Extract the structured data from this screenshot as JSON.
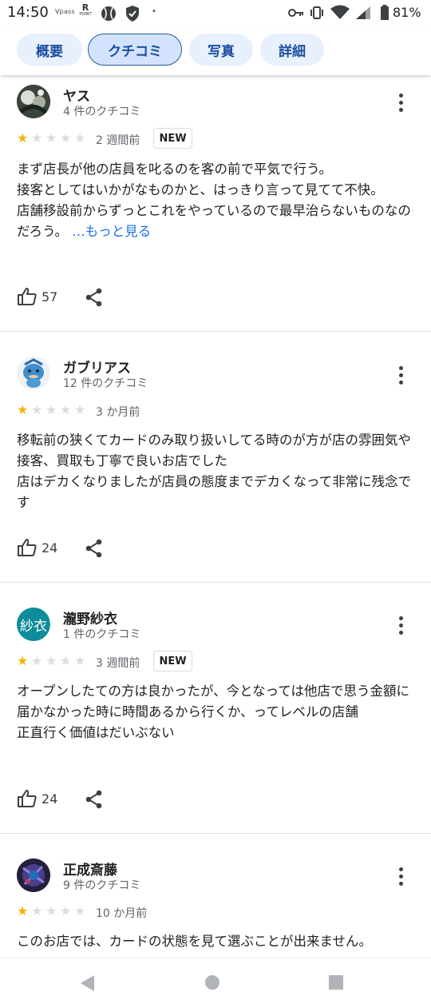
{
  "status_bar": {
    "time": "14:50",
    "app_icons": [
      "Vpass",
      "R POINT",
      "ball-icon",
      "shield-icon"
    ],
    "vpass_label": "Vpass",
    "rpoint_r": "R",
    "rpoint_label": "POINT",
    "dot": "•",
    "battery_percent": "81%"
  },
  "tabs": [
    {
      "label": "概要",
      "active": false
    },
    {
      "label": "クチコミ",
      "active": true
    },
    {
      "label": "写真",
      "active": false
    },
    {
      "label": "詳細",
      "active": false
    }
  ],
  "reviews": [
    {
      "name": "ヤス",
      "review_count": "4 件のクチコミ",
      "rating": 1,
      "time": "2 週間前",
      "badge": "NEW",
      "lines": [
        "まず店長が他の店員を叱るのを客の前で平気で行う。",
        "接客としてはいかがなものかと、はっきり言って見てて不快。",
        "店舗移設前からずっとこれをやっているので最早治らないものなのだろう。"
      ],
      "more_link": "…もっと見る",
      "likes": "57"
    },
    {
      "name": "ガブリアス",
      "review_count": "12 件のクチコミ",
      "rating": 1,
      "time": "3 か月前",
      "badge": "",
      "lines": [
        "移転前の狭くてカードのみ取り扱いしてる時のが方が店の雰囲気や接客、買取も丁寧で良いお店でした",
        "店はデカくなりましたが店員の態度までデカくなって非常に残念です"
      ],
      "more_link": "",
      "likes": "24"
    },
    {
      "name": "瀧野紗衣",
      "avatar_text": "紗衣",
      "review_count": "1 件のクチコミ",
      "rating": 1,
      "time": "3 週間前",
      "badge": "NEW",
      "lines": [
        "オープンしたての方は良かったが、今となっては他店で思う金額に届かなかった時に時間あるから行くか、ってレベルの店舗",
        "正直行く価値はだいぶない"
      ],
      "more_link": "",
      "likes": "24"
    },
    {
      "name": "正成斎藤",
      "review_count": "9 件のクチコミ",
      "rating": 1,
      "time": "10 か月前",
      "badge": "",
      "lines": [
        "このお店では、カードの状態を見て選ぶことが出来ません。"
      ],
      "more_link": "",
      "likes": ""
    }
  ],
  "colors": {
    "accent": "#1a73e8",
    "tab_bg": "#e8f0fe",
    "tab_active_border": "#1f5a97",
    "star_on": "#f4b400",
    "star_off": "#dadce0",
    "avatar_teal": "#0f8c9c"
  },
  "nav": [
    "back-icon",
    "home-icon",
    "recents-icon"
  ]
}
